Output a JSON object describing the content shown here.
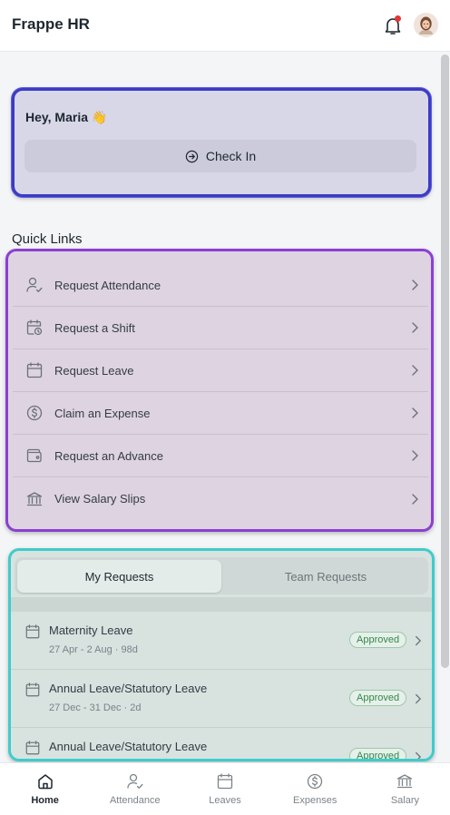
{
  "header": {
    "title": "Frappe HR",
    "notification_icon": "bell-icon",
    "notification_dot_color": "#e03636",
    "avatar_icon": "user-avatar"
  },
  "greeting": {
    "text": "Hey, Maria 👋",
    "checkin_label": "Check In"
  },
  "quick_links": {
    "title": "Quick Links",
    "items": [
      {
        "label": "Request Attendance",
        "icon": "user-check-icon"
      },
      {
        "label": "Request a Shift",
        "icon": "calendar-clock-icon"
      },
      {
        "label": "Request Leave",
        "icon": "calendar-icon"
      },
      {
        "label": "Claim an Expense",
        "icon": "dollar-circle-icon"
      },
      {
        "label": "Request an Advance",
        "icon": "wallet-icon"
      },
      {
        "label": "View Salary Slips",
        "icon": "bank-icon"
      }
    ]
  },
  "requests": {
    "tabs": [
      "My Requests",
      "Team Requests"
    ],
    "active_tab": "My Requests",
    "rows": [
      {
        "title": "Maternity Leave",
        "subtitle": "27 Apr - 2 Aug · 98d",
        "status": "Approved"
      },
      {
        "title": "Annual Leave/Statutory Leave",
        "subtitle": "27 Dec - 31 Dec · 2d",
        "status": "Approved"
      },
      {
        "title": "Annual Leave/Statutory Leave",
        "subtitle": "",
        "status": "Approved"
      }
    ],
    "status_color": "#31884a"
  },
  "nav": {
    "items": [
      {
        "label": "Home",
        "icon": "home-icon",
        "active": true
      },
      {
        "label": "Attendance",
        "icon": "user-check-icon",
        "active": false
      },
      {
        "label": "Leaves",
        "icon": "calendar-icon",
        "active": false
      },
      {
        "label": "Expenses",
        "icon": "dollar-circle-icon",
        "active": false
      },
      {
        "label": "Salary",
        "icon": "bank-icon",
        "active": false
      }
    ]
  }
}
